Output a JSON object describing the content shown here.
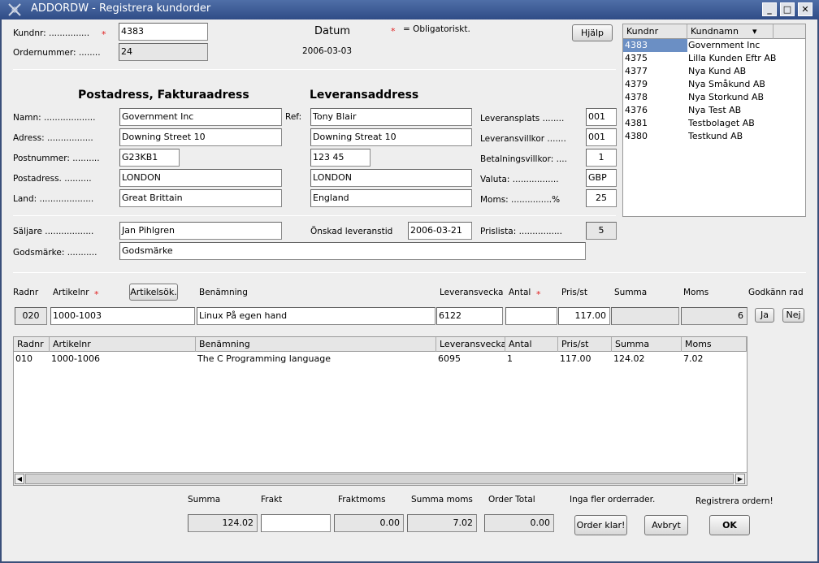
{
  "window": {
    "title": "ADDORDW - Registrera kundorder"
  },
  "header": {
    "kundnr_label": "Kundnr: ...............",
    "kundnr_value": "4383",
    "ordernr_label": "Ordernummer: ........",
    "ordernr_value": "24",
    "datum_label": "Datum",
    "datum_value": "2006-03-03",
    "required_marker": "*",
    "required_note": "= Obligatoriskt.",
    "help_button": "Hjälp"
  },
  "customer_list": {
    "col_kundnr": "Kundnr",
    "col_kundnamn": "Kundnamn",
    "rows": [
      {
        "nr": "4383",
        "name": "Government Inc",
        "selected": true
      },
      {
        "nr": "4375",
        "name": "Lilla Kunden Eftr AB"
      },
      {
        "nr": "4377",
        "name": "Nya Kund AB"
      },
      {
        "nr": "4379",
        "name": "Nya Småkund AB"
      },
      {
        "nr": "4378",
        "name": "Nya Storkund AB"
      },
      {
        "nr": "4376",
        "name": "Nya Test AB"
      },
      {
        "nr": "4381",
        "name": "Testbolaget AB"
      },
      {
        "nr": "4380",
        "name": "Testkund AB"
      }
    ]
  },
  "billing": {
    "heading": "Postadress, Fakturaadress",
    "namn_label": "Namn: ...................",
    "namn": "Government Inc",
    "adress_label": "Adress: .................",
    "adress": "Downing Street 10",
    "postnr_label": "Postnummer: ..........",
    "postnr": "G23KB1",
    "postadress_label": "Postadress. ..........",
    "postadress": "LONDON",
    "land_label": "Land: ....................",
    "land": "Great Brittain"
  },
  "delivery": {
    "heading": "Leveransaddress",
    "ref_label": "Ref:",
    "ref": "Tony Blair",
    "adress": "Downing Streat 10",
    "postnr": "123 45",
    "postadress": "LONDON",
    "land": "England"
  },
  "terms": {
    "leveransplats_label": "Leveransplats ........",
    "leveransplats": "001",
    "leveransvillkor_label": "Leveransvillkor .......",
    "leveransvillkor": "001",
    "betalningsvillkor_label": "Betalningsvillkor: ....",
    "betalningsvillkor": "1",
    "valuta_label": "Valuta: .................",
    "valuta": "GBP",
    "moms_label": "Moms: ...............%",
    "moms": "25"
  },
  "sales": {
    "saljare_label": "Säljare ..................",
    "saljare": "Jan Pihlgren",
    "onskad_label": "Önskad leveranstid",
    "onskad": "2006-03-21",
    "prislista_label": "Prislista: ................",
    "prislista": "5",
    "godsmarke_label": "Godsmärke: ...........",
    "godsmarke": "Godsmärke"
  },
  "entry": {
    "radnr_label": "Radnr",
    "artikelnr_label": "Artikelnr",
    "artikelsok_button": "Artikelsök.",
    "benamning_label": "Benämning",
    "leveransvecka_label": "Leveransvecka",
    "antal_label": "Antal",
    "pris_label": "Pris/st",
    "summa_label": "Summa",
    "moms_label": "Moms",
    "godkann_label": "Godkänn rad",
    "radnr": "020",
    "artikelnr": "1000-1003",
    "benamning": "Linux På egen hand",
    "leveransvecka": "6122",
    "antal": "",
    "pris": "117.00",
    "summa": "",
    "moms": "6",
    "ja_button": "Ja",
    "nej_button": "Nej"
  },
  "rows_table": {
    "columns": [
      "Radnr",
      "Artikelnr",
      "Benämning",
      "Leveransvecka",
      "Antal",
      "Pris/st",
      "Summa",
      "Moms"
    ],
    "rows": [
      [
        "010",
        "1000-1006",
        "The C Programming language",
        "6095",
        "1",
        "117.00",
        "124.02",
        "7.02"
      ]
    ]
  },
  "totals": {
    "summa_label": "Summa",
    "summa": "124.02",
    "frakt_label": "Frakt",
    "frakt": "",
    "fraktmoms_label": "Fraktmoms",
    "fraktmoms": "0.00",
    "summamoms_label": "Summa moms",
    "summamoms": "7.02",
    "ordertotal_label": "Order Total",
    "ordertotal": "0.00",
    "inga_fler_label": "Inga fler orderrader.",
    "order_klar_button": "Order klar!",
    "avbryt_button": "Avbryt",
    "registrera_label": "Registrera ordern!",
    "ok_button": "OK"
  }
}
